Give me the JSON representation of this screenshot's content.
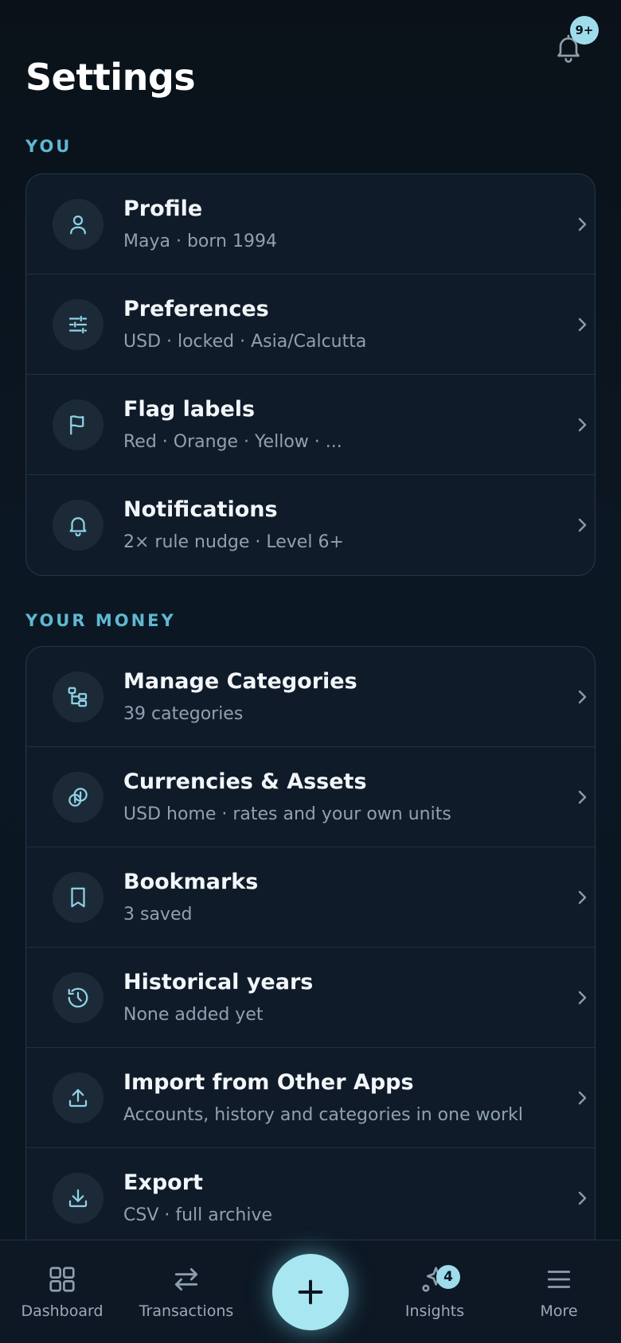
{
  "header": {
    "title": "Settings",
    "notification_badge": "9+"
  },
  "sections": [
    {
      "label": "YOU",
      "items": [
        {
          "title": "Profile",
          "subtitle": "Maya · born 1994",
          "icon": "person-icon"
        },
        {
          "title": "Preferences",
          "subtitle": "USD · locked · Asia/Calcutta",
          "icon": "sliders-icon"
        },
        {
          "title": "Flag labels",
          "subtitle": "Red · Orange · Yellow · ...",
          "icon": "flag-icon"
        },
        {
          "title": "Notifications",
          "subtitle": "2× rule nudge · Level 6+",
          "icon": "bell-icon"
        }
      ]
    },
    {
      "label": "YOUR MONEY",
      "items": [
        {
          "title": "Manage Categories",
          "subtitle": "39 categories",
          "icon": "category-tree-icon"
        },
        {
          "title": "Currencies & Assets",
          "subtitle": "USD home · rates and your own units",
          "icon": "coins-icon"
        },
        {
          "title": "Bookmarks",
          "subtitle": "3 saved",
          "icon": "bookmark-icon"
        },
        {
          "title": "Historical years",
          "subtitle": "None added yet",
          "icon": "history-icon"
        },
        {
          "title": "Import from Other Apps",
          "subtitle": "Accounts, history and categories in one workb...",
          "icon": "upload-icon"
        },
        {
          "title": "Export",
          "subtitle": "CSV · full archive",
          "icon": "download-icon"
        }
      ]
    }
  ],
  "nav": {
    "items": [
      {
        "label": "Dashboard",
        "icon": "grid-icon"
      },
      {
        "label": "Transactions",
        "icon": "arrows-swap-icon"
      },
      {
        "label": "Insights",
        "icon": "sparkle-chart-icon",
        "badge": "4"
      },
      {
        "label": "More",
        "icon": "menu-icon"
      }
    ],
    "fab_icon": "plus-icon"
  },
  "colors": {
    "accent": "#9fdceb",
    "section_label": "#5fb8d2",
    "background": "#0b1520",
    "card": "#0f1b28"
  }
}
